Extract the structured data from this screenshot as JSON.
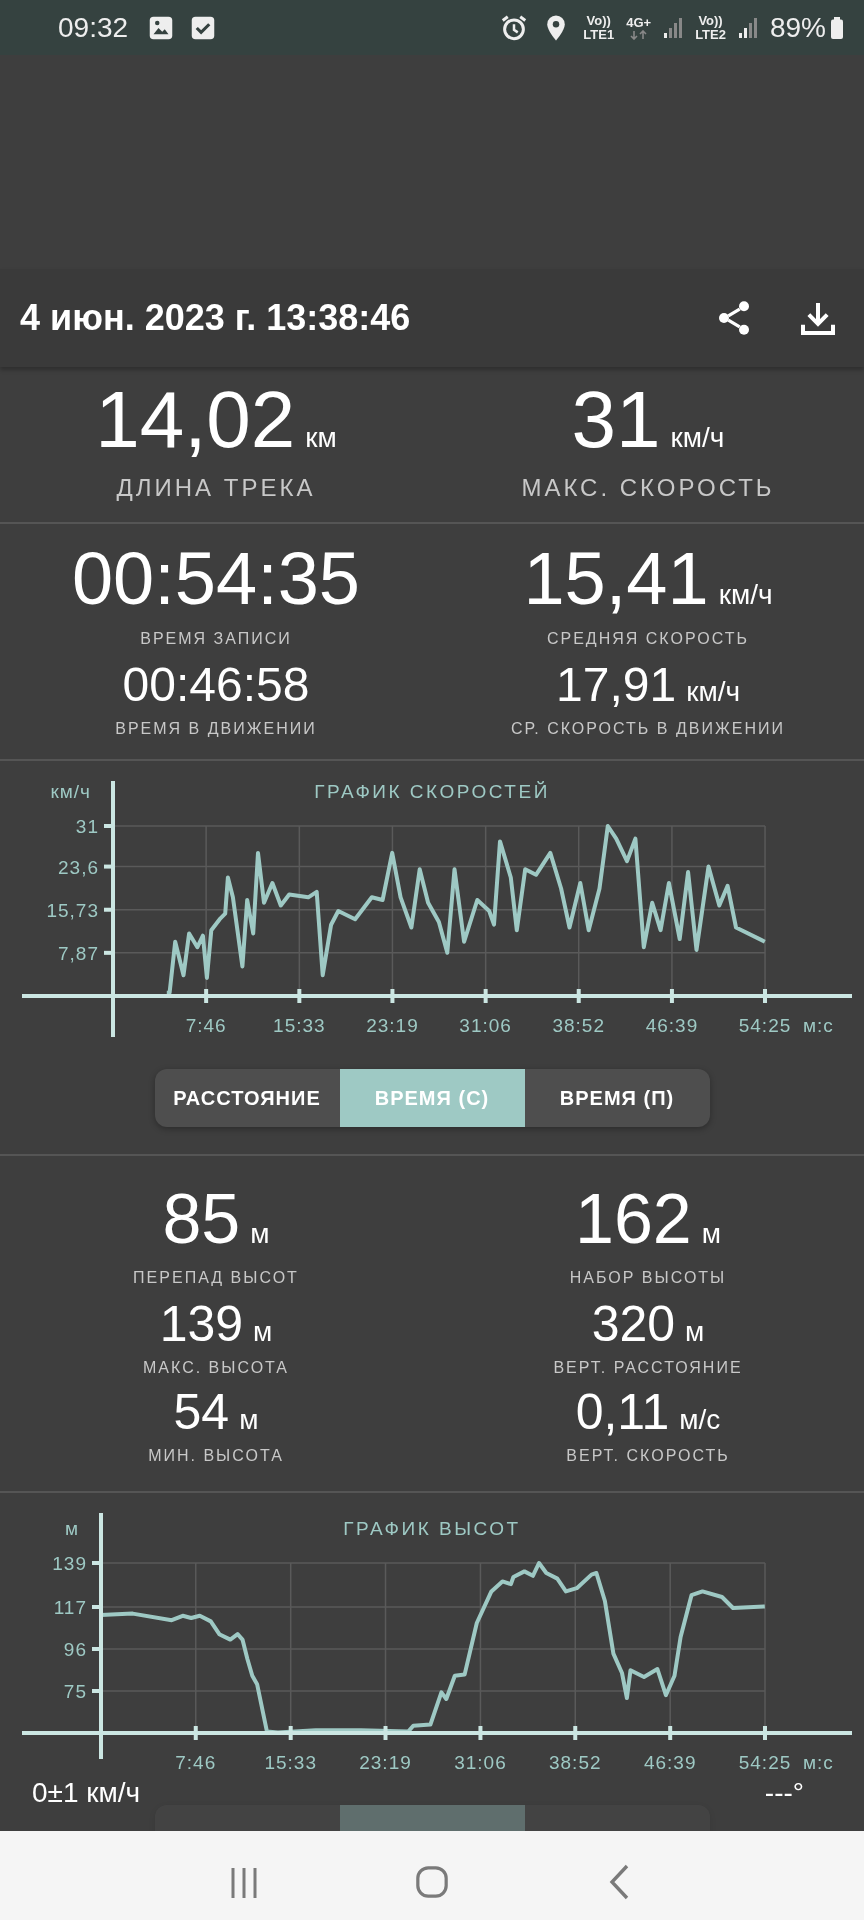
{
  "status_bar": {
    "time": "09:32",
    "sim1_top": "Vo))",
    "sim1_bottom": "LTE1",
    "network": "4G+",
    "sim2_top": "Vo))",
    "sim2_bottom": "LTE2",
    "battery": "89%"
  },
  "header": {
    "title": "4 июн. 2023 г. 13:38:46"
  },
  "summary": {
    "rows": [
      {
        "kind": "hero",
        "cells": [
          {
            "value": "14,02",
            "unit": "км",
            "label": "ДЛИНА ТРЕКА"
          },
          {
            "value": "31",
            "unit": "км/ч",
            "label": "МАКС. СКОРОСТЬ"
          }
        ]
      }
    ]
  },
  "time_stats": {
    "rows": [
      {
        "kind": "large",
        "cells": [
          {
            "value": "00:54:35",
            "label": "ВРЕМЯ ЗАПИСИ"
          },
          {
            "value": "15,41",
            "unit": "км/ч",
            "label": "СРЕДНЯЯ СКОРОСТЬ"
          }
        ]
      },
      {
        "kind": "medium",
        "cells": [
          {
            "value": "00:46:58",
            "label": "ВРЕМЯ В ДВИЖЕНИИ"
          },
          {
            "value": "17,91",
            "unit": "км/ч",
            "label": "СР. СКОРОСТЬ В ДВИЖЕНИИ"
          }
        ]
      }
    ]
  },
  "speed_chart": {
    "chart_data": {
      "type": "line",
      "title": "ГРАФИК СКОРОСТЕЙ",
      "xlabel": "м:с",
      "ylabel": "км/ч",
      "xlim": [
        -7.6,
        61.68
      ],
      "ylim": [
        0,
        31
      ],
      "grid": true,
      "xticks": [
        {
          "value": 7.77,
          "label": "7:46"
        },
        {
          "value": 15.55,
          "label": "15:33"
        },
        {
          "value": 23.32,
          "label": "23:19"
        },
        {
          "value": 31.1,
          "label": "31:06"
        },
        {
          "value": 38.87,
          "label": "38:52"
        },
        {
          "value": 46.65,
          "label": "46:39"
        },
        {
          "value": 54.42,
          "label": "54:25"
        }
      ],
      "yticks": [
        {
          "value": 7.87,
          "label": "7,87"
        },
        {
          "value": 15.73,
          "label": "15,73"
        },
        {
          "value": 23.6,
          "label": "23,6"
        },
        {
          "value": 31,
          "label": "31"
        }
      ],
      "x": [
        4.49,
        4.72,
        5.19,
        5.88,
        6.35,
        7.04,
        7.5,
        7.83,
        8.2,
        8.9,
        9.36,
        9.59,
        10,
        10.8,
        11.2,
        11.7,
        12.1,
        12.6,
        13.3,
        14,
        14.7,
        16.3,
        17,
        17.5,
        18.2,
        18.8,
        20.2,
        21.6,
        22.5,
        23.3,
        24,
        24.9,
        25.6,
        26.3,
        27.2,
        27.9,
        28.5,
        29.3,
        30.4,
        31.4,
        31.8,
        32.3,
        33.2,
        33.7,
        34.4,
        35.3,
        36.5,
        37.4,
        38.1,
        39,
        39.7,
        40.6,
        41.3,
        42,
        42.9,
        43.6,
        44.3,
        45,
        45.7,
        46.4,
        47.3,
        48,
        48.7,
        49.7,
        50.6,
        51.3,
        52,
        54.4
      ],
      "series": [
        {
          "color": "#9ec9c4",
          "values": [
            0.6,
            0.6,
            9.9,
            3.8,
            11.4,
            8.9,
            11,
            3.3,
            12,
            14,
            15,
            21.6,
            18,
            5.4,
            17.5,
            11.4,
            26.1,
            17,
            20.6,
            16.5,
            18.5,
            18,
            19,
            3.8,
            13,
            15.5,
            14,
            18,
            17.5,
            26.1,
            18,
            12.5,
            23.1,
            17,
            13.5,
            7.9,
            23.1,
            9.9,
            17.5,
            15.5,
            13,
            28.2,
            21.6,
            12,
            23.1,
            22.1,
            26.1,
            19.6,
            12.5,
            20.6,
            12,
            19.6,
            31,
            28.7,
            24.6,
            28.7,
            8.9,
            17,
            12,
            20.6,
            10.4,
            22.6,
            8.4,
            23.6,
            16.5,
            20.1,
            12.5,
            9.9
          ]
        }
      ]
    },
    "toggle": [
      {
        "label": "РАССТОЯНИЕ",
        "selected": false
      },
      {
        "label": "ВРЕМЯ (С)",
        "selected": true
      },
      {
        "label": "ВРЕМЯ (П)",
        "selected": false
      }
    ]
  },
  "elevation_stats": {
    "rows": [
      {
        "kind": "large",
        "cells": [
          {
            "value": "85",
            "unit": "м",
            "label": "ПЕРЕПАД ВЫСОТ"
          },
          {
            "value": "162",
            "unit": "м",
            "label": "НАБОР ВЫСОТЫ"
          }
        ]
      },
      {
        "kind": "medium",
        "cells": [
          {
            "value": "139",
            "unit": "м",
            "label": "МАКС. ВЫСОТА"
          },
          {
            "value": "320",
            "unit": "м",
            "label": "ВЕРТ. РАССТОЯНИЕ"
          }
        ]
      },
      {
        "kind": "medium",
        "cells": [
          {
            "value": "54",
            "unit": "м",
            "label": "МИН. ВЫСОТА"
          },
          {
            "value": "0,11",
            "unit": "м/с",
            "label": "ВЕРТ. СКОРОСТЬ"
          }
        ]
      }
    ]
  },
  "elevation_chart": {
    "chart_data": {
      "type": "line",
      "title": "ГРАФИК ВЫСОТ",
      "xlabel": "м:с",
      "ylabel": "м",
      "xlim": [
        -6.47,
        61.55
      ],
      "ylim": [
        54,
        139
      ],
      "grid": true,
      "xticks": [
        {
          "value": 7.77,
          "label": "7:46"
        },
        {
          "value": 15.55,
          "label": "15:33"
        },
        {
          "value": 23.32,
          "label": "23:19"
        },
        {
          "value": 31.1,
          "label": "31:06"
        },
        {
          "value": 38.87,
          "label": "38:52"
        },
        {
          "value": 46.65,
          "label": "46:39"
        },
        {
          "value": 54.42,
          "label": "54:25"
        }
      ],
      "yticks": [
        {
          "value": 75,
          "label": "75"
        },
        {
          "value": 96,
          "label": "96"
        },
        {
          "value": 117,
          "label": "117"
        },
        {
          "value": 139,
          "label": "139"
        }
      ],
      "x": [
        0,
        2.6,
        5.8,
        6.7,
        7.4,
        8.1,
        9,
        9.7,
        10.6,
        11.2,
        11.6,
        12,
        12.4,
        12.8,
        13.6,
        14.5,
        17.6,
        21.3,
        25.2,
        25.6,
        27,
        27.9,
        28.3,
        29,
        29.8,
        30.8,
        32,
        32.9,
        33.6,
        33.8,
        34.7,
        35.4,
        35.9,
        36.5,
        37.4,
        38.1,
        39,
        40.2,
        40.6,
        41.3,
        42,
        42.7,
        43.1,
        43.4,
        44.5,
        45.6,
        46.3,
        47,
        47.5,
        48.4,
        49.3,
        50.9,
        51.8,
        54.4
      ],
      "series": [
        {
          "color": "#9ec9c4",
          "values": [
            113,
            113.7,
            110.4,
            112.6,
            111.5,
            112.6,
            109.8,
            103.4,
            100.7,
            103.4,
            100.7,
            91,
            82.6,
            78.4,
            54.8,
            54.3,
            55.4,
            55.4,
            54.8,
            57.6,
            58.2,
            74.3,
            71,
            82.6,
            83.2,
            109,
            124.8,
            129.8,
            128.4,
            132,
            134.8,
            132.6,
            139,
            134,
            131.2,
            124.8,
            126.4,
            133.2,
            134,
            120,
            93.7,
            84,
            71.5,
            85.4,
            82,
            86,
            72.9,
            82.6,
            102,
            122.9,
            124.8,
            122,
            116.5,
            117.3
          ]
        }
      ]
    },
    "toggle": [
      {
        "selected": false
      },
      {
        "selected": true
      },
      {
        "selected": false
      }
    ]
  },
  "overlay": {
    "speed": "0±1 км/ч",
    "heading": "---°"
  }
}
